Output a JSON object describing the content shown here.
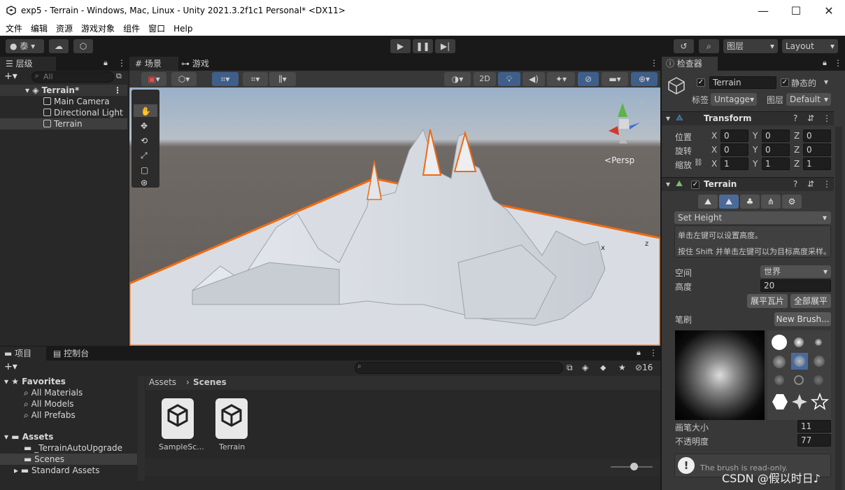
{
  "window": {
    "title": "exp5 - Terrain - Windows, Mac, Linux - Unity 2021.3.2f1c1 Personal* <DX11>",
    "minimize": "—",
    "maximize": "☐",
    "close": "✕"
  },
  "menu": [
    "文件",
    "编辑",
    "资源",
    "游戏对象",
    "组件",
    "窗口",
    "Help"
  ],
  "toolbar": {
    "account": "泰",
    "layers": "图层",
    "layout": "Layout"
  },
  "hierarchy": {
    "tab": "层级",
    "search_placeholder": "All",
    "scene": "Terrain*",
    "items": [
      "Main Camera",
      "Directional Light",
      "Terrain"
    ]
  },
  "scene_view": {
    "tab_scene": "场景",
    "tab_game": "游戏",
    "mode_2d": "2D",
    "persp": "Persp",
    "axis_x": "x",
    "axis_z": "z"
  },
  "inspector": {
    "tab": "检查器",
    "object_name": "Terrain",
    "static_label": "静态的",
    "tag_label": "标签",
    "tag_value": "Untagge▾",
    "layer_label": "图层",
    "layer_value": "Default",
    "transform": {
      "title": "Transform",
      "position": "位置",
      "rotation": "旋转",
      "scale": "缩放",
      "pos": [
        "0",
        "0",
        "0"
      ],
      "rot": [
        "0",
        "0",
        "0"
      ],
      "scl": [
        "1",
        "1",
        "1"
      ],
      "axes": [
        "X",
        "Y",
        "Z"
      ]
    },
    "terrain": {
      "title": "Terrain",
      "tool": "Set Height",
      "help1": "单击左键可以设置高度。",
      "help2": "按住 Shift 并单击左键可以为目标高度采样。",
      "space_label": "空间",
      "space_value": "世界",
      "height_label": "高度",
      "height_value": "20",
      "flatten_tile": "展平瓦片",
      "flatten_all": "全部展平",
      "brush_label": "笔刷",
      "new_brush": "New Brush...",
      "brush_size_label": "画笔大小",
      "brush_size": "11",
      "opacity_label": "不透明度",
      "opacity": "77",
      "readonly": "The brush is read-only."
    }
  },
  "project": {
    "tab_project": "项目",
    "tab_console": "控制台",
    "hidden_count": "16",
    "favorites": "Favorites",
    "fav_items": [
      "All Materials",
      "All Models",
      "All Prefabs"
    ],
    "assets": "Assets",
    "asset_folders": [
      "_TerrainAutoUpgrade",
      "Scenes",
      "Standard Assets"
    ],
    "breadcrumb_root": "Assets",
    "breadcrumb_current": "Scenes",
    "files": [
      "SampleSc...",
      "Terrain"
    ]
  },
  "watermark": "CSDN @假以时日♪"
}
